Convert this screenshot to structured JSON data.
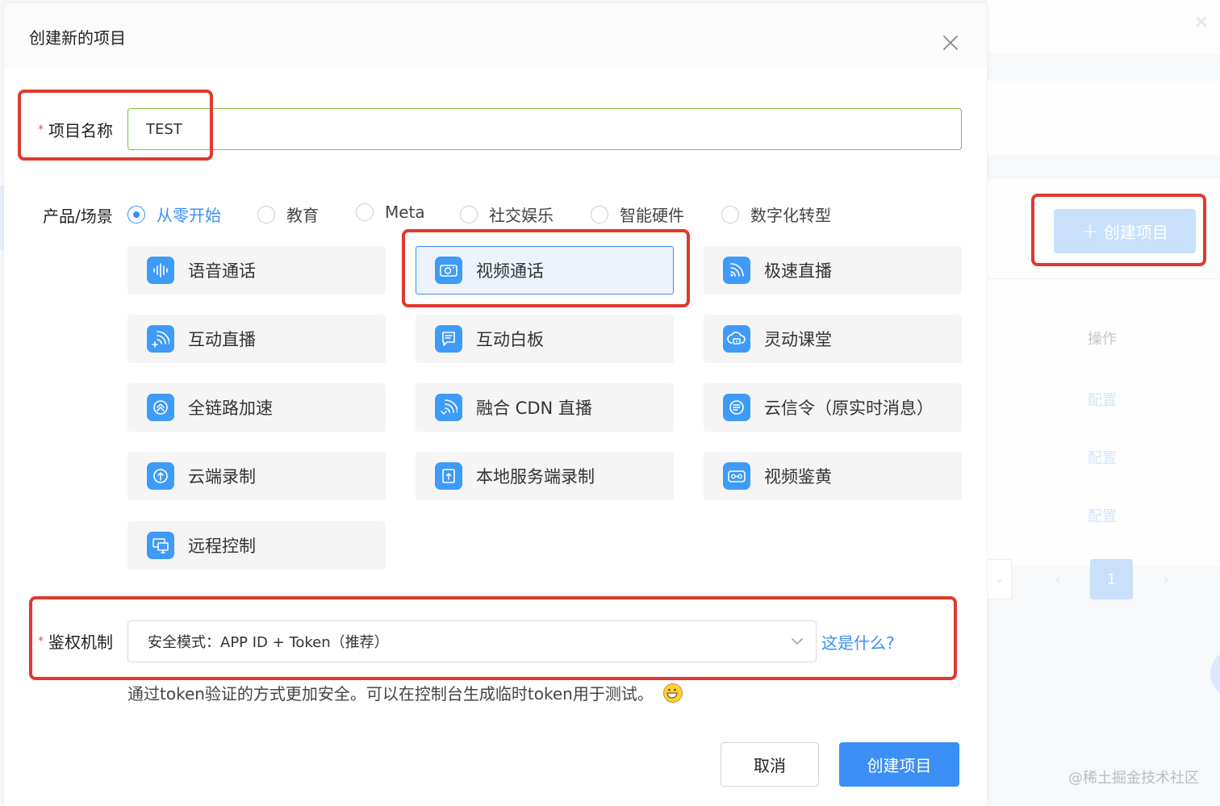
{
  "modal": {
    "title": "创建新的项目",
    "close_icon": "close-icon"
  },
  "form": {
    "name": {
      "label": "项目名称",
      "required_mark": "*",
      "value": "TEST"
    },
    "scene": {
      "label": "产品/场景",
      "options": [
        {
          "label": "从零开始",
          "checked": true
        },
        {
          "label": "教育",
          "checked": false
        },
        {
          "label": "Meta",
          "checked": false
        },
        {
          "label": "社交娱乐",
          "checked": false
        },
        {
          "label": "智能硬件",
          "checked": false
        },
        {
          "label": "数字化转型",
          "checked": false
        }
      ]
    },
    "products": [
      {
        "label": "语音通话",
        "icon": "waveform-icon",
        "selected": false
      },
      {
        "label": "视频通话",
        "icon": "camera-icon",
        "selected": true
      },
      {
        "label": "极速直播",
        "icon": "broadcast-icon",
        "selected": false
      },
      {
        "label": "互动直播",
        "icon": "broadcast-plus-icon",
        "selected": false
      },
      {
        "label": "互动白板",
        "icon": "whiteboard-icon",
        "selected": false
      },
      {
        "label": "灵动课堂",
        "icon": "classroom-icon",
        "selected": false
      },
      {
        "label": "全链路加速",
        "icon": "accelerate-icon",
        "selected": false
      },
      {
        "label": "融合 CDN 直播",
        "icon": "cdn-broadcast-icon",
        "selected": false
      },
      {
        "label": "云信令（原实时消息）",
        "icon": "message-icon",
        "selected": false
      },
      {
        "label": "云端录制",
        "icon": "cloud-upload-icon",
        "selected": false
      },
      {
        "label": "本地服务端录制",
        "icon": "local-record-icon",
        "selected": false
      },
      {
        "label": "视频鉴黄",
        "icon": "content-moderation-icon",
        "selected": false
      },
      {
        "label": "远程控制",
        "icon": "remote-desktop-icon",
        "selected": false
      }
    ],
    "auth": {
      "label": "鉴权机制",
      "required_mark": "*",
      "selected": "安全模式：APP ID + Token（推荐）",
      "help_link": "这是什么?",
      "description": "通过token验证的方式更加安全。可以在控制台生成临时token用于测试。"
    }
  },
  "buttons": {
    "cancel": "取消",
    "create": "创建项目"
  },
  "background": {
    "create_button": "创建项目",
    "column_header": "操作",
    "row_action": "配置",
    "current_page": "1",
    "watermark": "@稀土掘金技术社区"
  },
  "colors": {
    "primary": "#3b8ff5",
    "highlight": "#e0392f",
    "input_valid": "#7cbf44",
    "required": "#e34d59"
  }
}
